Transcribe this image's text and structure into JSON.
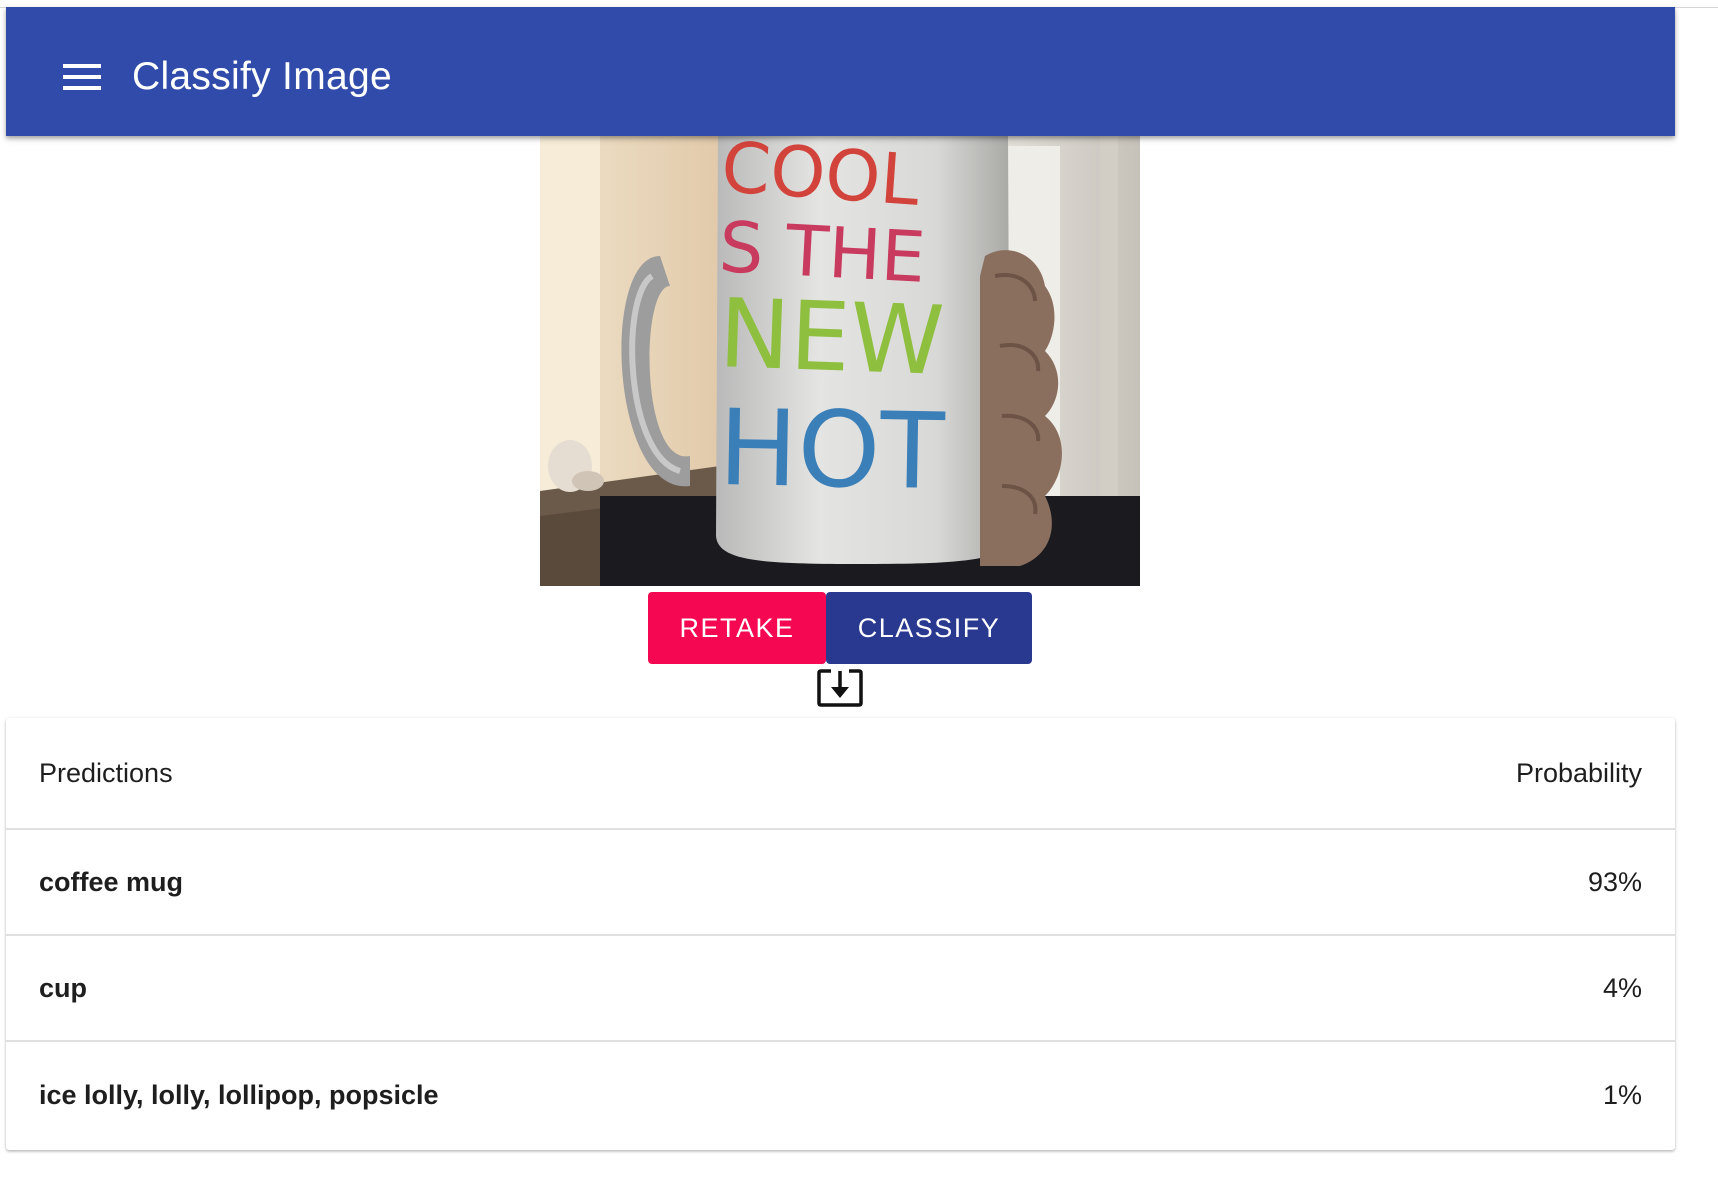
{
  "appbar": {
    "title": "Classify Image",
    "color": "#304ba9"
  },
  "photo": {
    "description_icon": "camera-capture-image"
  },
  "actions": {
    "retake_label": "RETAKE",
    "classify_label": "CLASSIFY",
    "retake_color": "#f50752",
    "classify_color": "#29398f",
    "download_icon": "download-icon"
  },
  "table": {
    "header": {
      "predictions": "Predictions",
      "probability": "Probability"
    },
    "rows": [
      {
        "label": "coffee mug",
        "probability": "93%"
      },
      {
        "label": "cup",
        "probability": "4%"
      },
      {
        "label": "ice lolly, lolly, lollipop, popsicle",
        "probability": "1%"
      }
    ]
  }
}
